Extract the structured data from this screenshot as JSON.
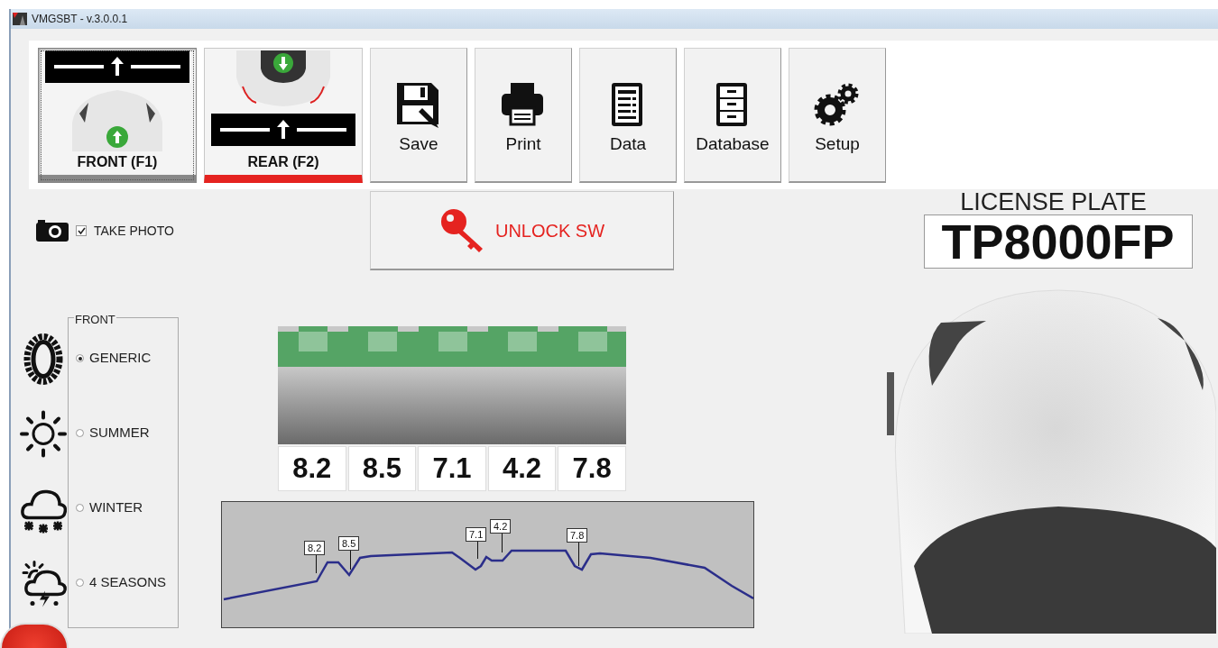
{
  "window": {
    "title": "VMGSBT - v.3.0.0.1"
  },
  "axle_buttons": [
    {
      "label": "FRONT (F1)",
      "kind": "front",
      "selected": true
    },
    {
      "label": "REAR (F2)",
      "kind": "rear",
      "selected": false
    }
  ],
  "toolbar": [
    {
      "label": "Save",
      "kind": "save"
    },
    {
      "label": "Print",
      "kind": "print"
    },
    {
      "label": "Data",
      "kind": "data"
    },
    {
      "label": "Database",
      "kind": "database"
    },
    {
      "label": "Setup",
      "kind": "setup"
    }
  ],
  "take_photo": {
    "label": "TAKE PHOTO",
    "checked": true
  },
  "unlock_button": {
    "label": "UNLOCK SW"
  },
  "license_plate": {
    "label": "LICENSE PLATE",
    "value": "TP8000FP"
  },
  "tire_type": {
    "title": "FRONT",
    "options": [
      {
        "label": "GENERIC",
        "kind": "generic",
        "selected": true
      },
      {
        "label": "SUMMER",
        "kind": "summer",
        "selected": false
      },
      {
        "label": "WINTER",
        "kind": "winter",
        "selected": false
      },
      {
        "label": "4 SEASONS",
        "kind": "all-season",
        "selected": false
      }
    ]
  },
  "tread": {
    "readings": [
      "8.2",
      "8.5",
      "7.1",
      "4.2",
      "7.8"
    ]
  },
  "profile": {
    "markers": [
      "8.2",
      "8.5",
      "7.1",
      "4.2",
      "7.8"
    ]
  }
}
